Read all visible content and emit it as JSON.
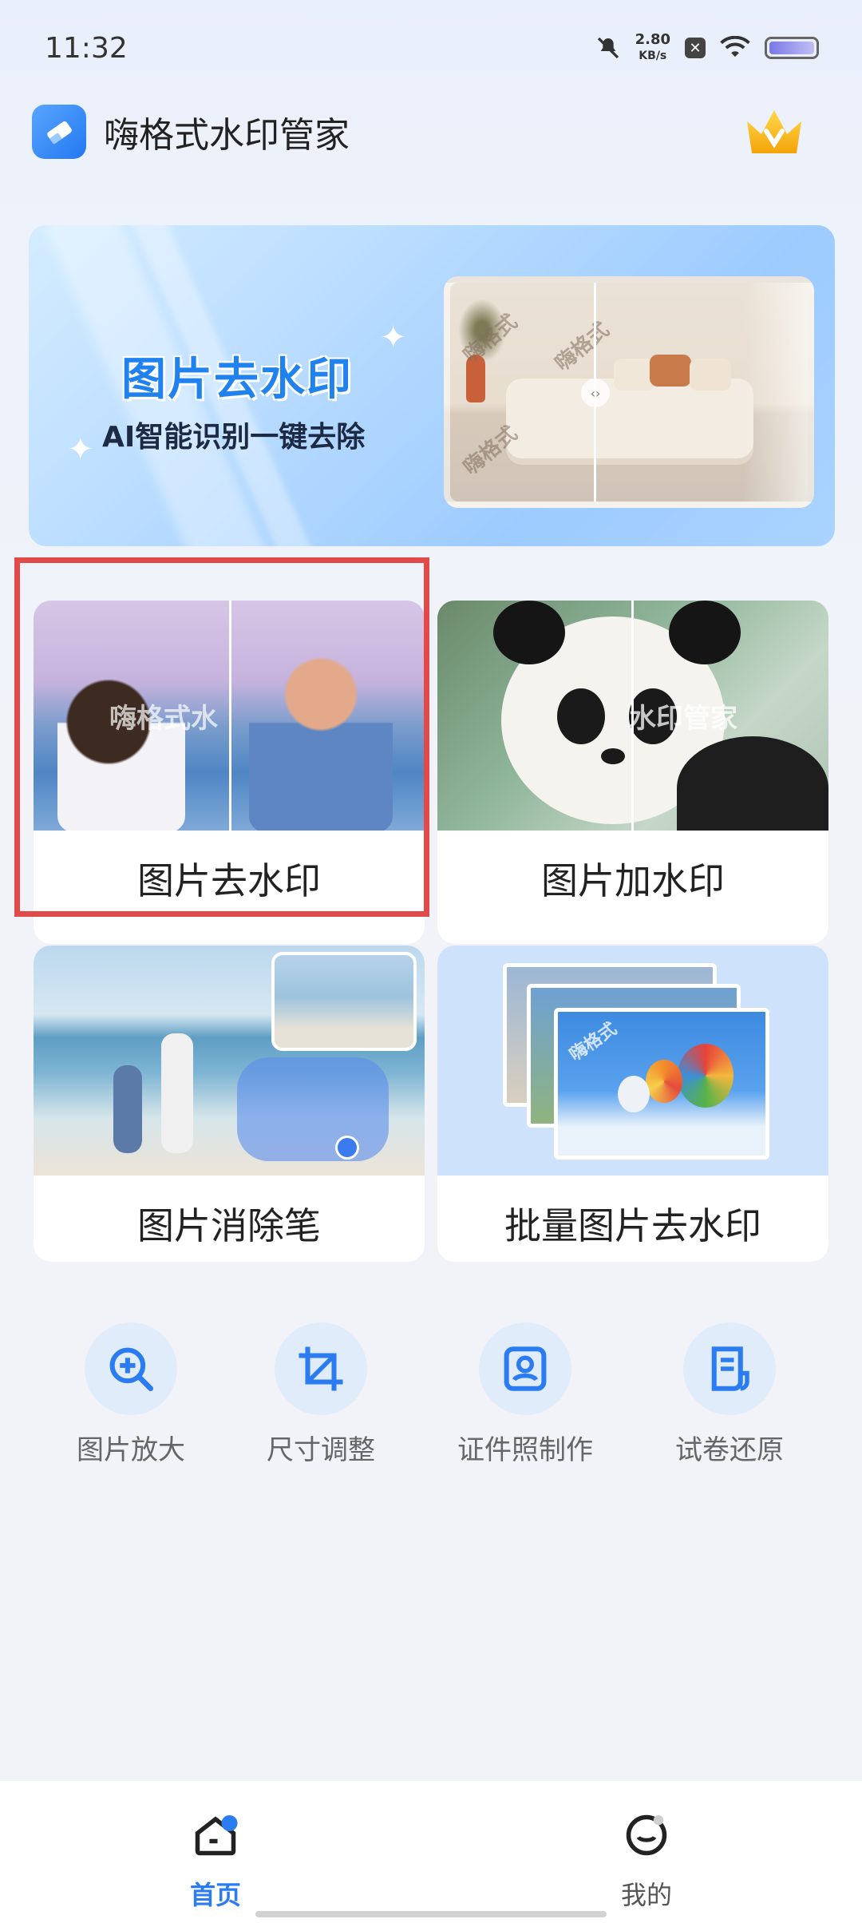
{
  "status": {
    "time": "11:32",
    "speed_value": "2.80",
    "speed_unit": "KB/s"
  },
  "header": {
    "title": "嗨格式水印管家",
    "vip_icon": "crown-icon"
  },
  "banner": {
    "title": "图片去水印",
    "subtitle": "AI智能识别一键去除",
    "watermark_text": "嗨格式"
  },
  "features": [
    {
      "label": "图片去水印",
      "watermark": "嗨格式水"
    },
    {
      "label": "图片加水印",
      "watermark": "水印管家"
    },
    {
      "label": "图片消除笔"
    },
    {
      "label": "批量图片去水印",
      "watermark": "嗨格式"
    }
  ],
  "tools": [
    {
      "label": "图片放大",
      "icon": "zoom-in-icon"
    },
    {
      "label": "尺寸调整",
      "icon": "crop-icon"
    },
    {
      "label": "证件照制作",
      "icon": "id-photo-icon"
    },
    {
      "label": "试卷还原",
      "icon": "document-icon"
    }
  ],
  "nav": {
    "items": [
      {
        "label": "首页",
        "icon": "home-icon",
        "active": true
      },
      {
        "label": "我的",
        "icon": "profile-icon",
        "active": false
      }
    ]
  },
  "colors": {
    "accent": "#2b7cf0",
    "highlight": "#e24a4a"
  }
}
